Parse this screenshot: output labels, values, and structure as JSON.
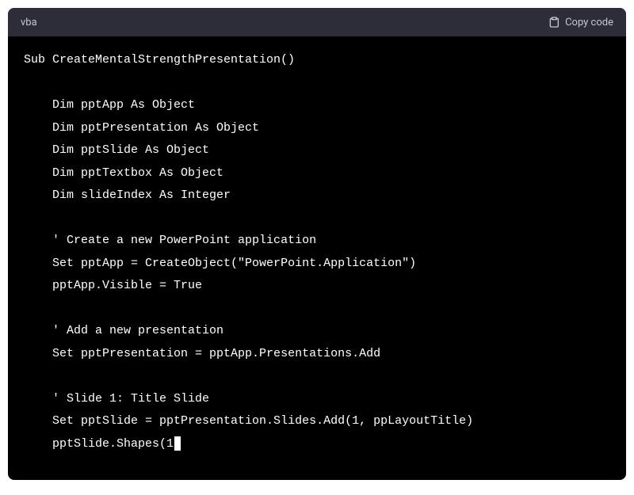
{
  "header": {
    "language": "vba",
    "copy_label": "Copy code"
  },
  "code": {
    "content": "Sub CreateMentalStrengthPresentation()\n\n    Dim pptApp As Object\n    Dim pptPresentation As Object\n    Dim pptSlide As Object\n    Dim pptTextbox As Object\n    Dim slideIndex As Integer\n\n    ' Create a new PowerPoint application\n    Set pptApp = CreateObject(\"PowerPoint.Application\")\n    pptApp.Visible = True\n\n    ' Add a new presentation\n    Set pptPresentation = pptApp.Presentations.Add\n\n    ' Slide 1: Title Slide\n    Set pptSlide = pptPresentation.Slides.Add(1, ppLayoutTitle)\n    pptSlide.Shapes(1"
  }
}
